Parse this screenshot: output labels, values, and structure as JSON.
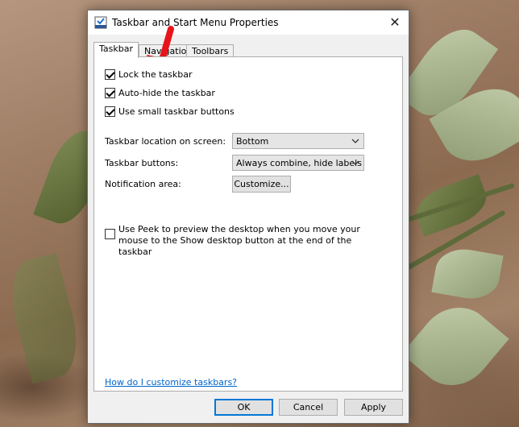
{
  "window": {
    "title": "Taskbar and Start Menu Properties",
    "close_glyph": "✕"
  },
  "tabs": [
    {
      "label": "Taskbar",
      "active": true
    },
    {
      "label": "Navigation",
      "active": false
    },
    {
      "label": "Toolbars",
      "active": false
    }
  ],
  "taskbar": {
    "options": [
      {
        "label": "Lock the taskbar",
        "checked": true
      },
      {
        "label": "Auto-hide the taskbar",
        "checked": true
      },
      {
        "label": "Use small taskbar buttons",
        "checked": true
      }
    ],
    "location": {
      "label": "Taskbar location on screen:",
      "value": "Bottom"
    },
    "buttons": {
      "label": "Taskbar buttons:",
      "value": "Always combine, hide labels"
    },
    "notification": {
      "label": "Notification area:",
      "button": "Customize..."
    },
    "peek": {
      "label": "Use Peek to preview the desktop when you move your mouse to the Show desktop button at the end of the taskbar",
      "checked": false
    },
    "help_link": "How do I customize taskbars?"
  },
  "footer": {
    "ok": "OK",
    "cancel": "Cancel",
    "apply": "Apply"
  },
  "annotation": {
    "arrow_color": "#e8141b",
    "icon": "red-arrow-icon"
  },
  "colors": {
    "link": "#0066cc",
    "default_button_border": "#0078d7"
  }
}
